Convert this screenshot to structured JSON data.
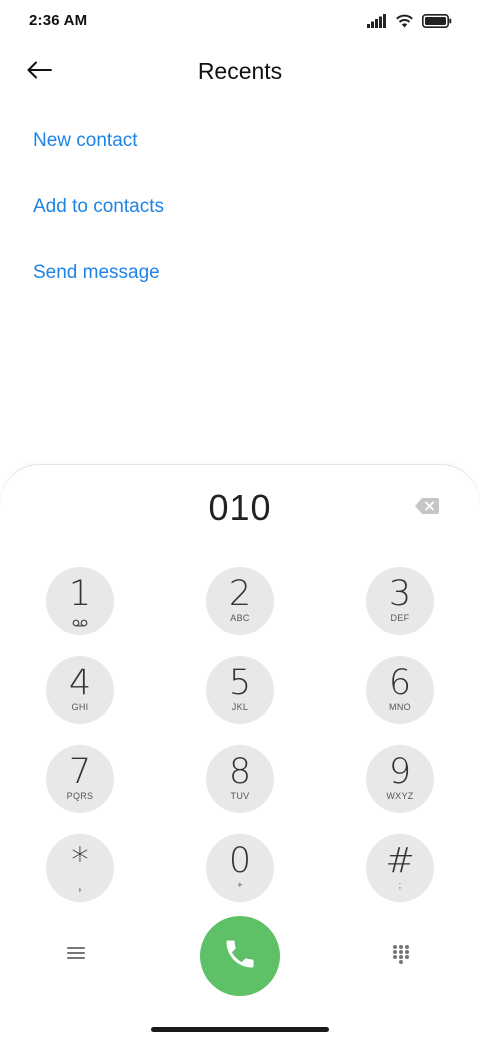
{
  "status_bar": {
    "time": "2:36 AM",
    "icons": [
      "signal-icon",
      "wifi-icon",
      "battery-icon"
    ]
  },
  "header": {
    "title": "Recents",
    "back_icon": "arrow-left-icon"
  },
  "actions": [
    {
      "label": "New contact"
    },
    {
      "label": "Add to contacts"
    },
    {
      "label": "Send message"
    }
  ],
  "dialer": {
    "number": "010",
    "backspace_icon": "backspace-icon",
    "keys": [
      {
        "digit": "1",
        "letters": "",
        "sub_icon": "voicemail-icon"
      },
      {
        "digit": "2",
        "letters": "ABC"
      },
      {
        "digit": "3",
        "letters": "DEF"
      },
      {
        "digit": "4",
        "letters": "GHI"
      },
      {
        "digit": "5",
        "letters": "JKL"
      },
      {
        "digit": "6",
        "letters": "MNO"
      },
      {
        "digit": "7",
        "letters": "PQRS"
      },
      {
        "digit": "8",
        "letters": "TUV"
      },
      {
        "digit": "9",
        "letters": "WXYZ"
      },
      {
        "digit": "*",
        "letters": ","
      },
      {
        "digit": "0",
        "letters": "+"
      },
      {
        "digit": "#",
        "letters": ";"
      }
    ],
    "menu_icon": "menu-icon",
    "call_icon": "phone-icon",
    "keypad_icon": "dialpad-icon"
  },
  "colors": {
    "accent": "#1d84e6",
    "call_button": "#5ec167",
    "key_background": "#e8e8e8"
  }
}
